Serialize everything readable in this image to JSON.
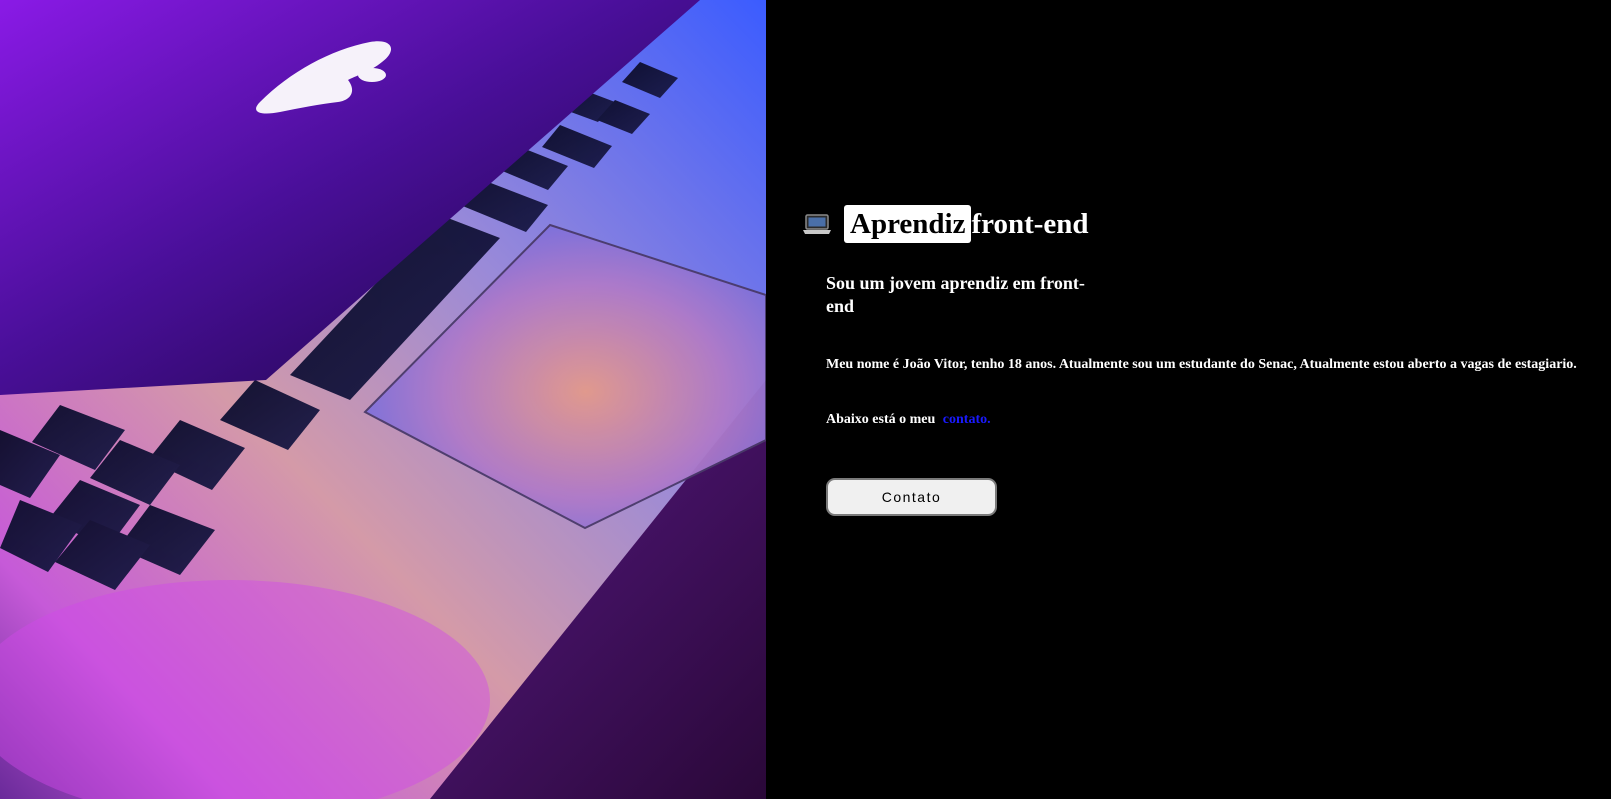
{
  "hero": {
    "image_description_icon": "laptop-photo"
  },
  "header": {
    "emoji_icon": "laptop-icon",
    "title_highlight": "Aprendiz",
    "title_rest": "front-end"
  },
  "intro": {
    "subtitle": "Sou um jovem aprendiz em front-end",
    "bio": "Meu nome é João Vitor, tenho 18 anos. Atualmente sou um estudante do Senac, Atualmente estou aberto a vagas de estagiario.",
    "contact_prefix": "Abaixo está o meu",
    "contact_link": "contato."
  },
  "actions": {
    "contact_button": "Contato"
  },
  "colors": {
    "background": "#000000",
    "text": "#ffffff",
    "link": "#1a1aff",
    "button_bg": "#f0f0f0"
  }
}
